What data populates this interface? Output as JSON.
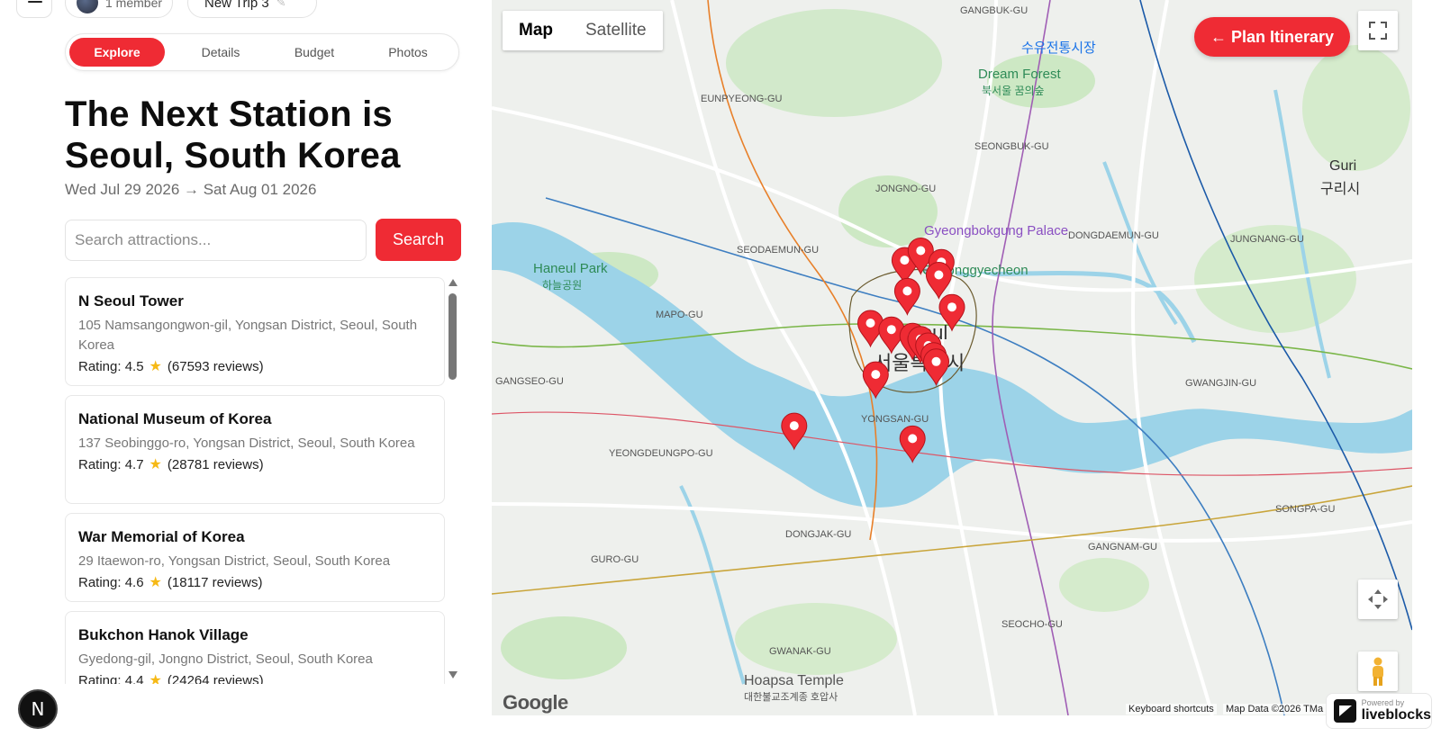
{
  "header": {
    "member_label": "1 member",
    "trip_name": "New Trip 3"
  },
  "tabs": [
    {
      "label": "Explore",
      "active": true
    },
    {
      "label": "Details",
      "active": false
    },
    {
      "label": "Budget",
      "active": false
    },
    {
      "label": "Photos",
      "active": false
    }
  ],
  "trip": {
    "title": "The Next Station is Seoul, South Korea",
    "dates": "Wed Jul 29 2026 → Sat Aug 01 2026"
  },
  "search": {
    "placeholder": "Search attractions...",
    "button_label": "Search"
  },
  "attractions": [
    {
      "name": "N Seoul Tower",
      "address": "105 Namsangongwon-gil, Yongsan District, Seoul, South Korea",
      "rating_text": "Rating: 4.5",
      "reviews_text": "(67593 reviews)"
    },
    {
      "name": "National Museum of Korea",
      "address": "137 Seobinggo-ro, Yongsan District, Seoul, South Korea",
      "rating_text": "Rating: 4.7",
      "reviews_text": "(28781 reviews)"
    },
    {
      "name": "War Memorial of Korea",
      "address": "29 Itaewon-ro, Yongsan District, Seoul, South Korea",
      "rating_text": "Rating: 4.6",
      "reviews_text": "(18117 reviews)"
    },
    {
      "name": "Bukchon Hanok Village",
      "address": "Gyedong-gil, Jongno District, Seoul, South Korea",
      "rating_text": "Rating: 4.4",
      "reviews_text": "(24264 reviews)"
    }
  ],
  "map": {
    "type_buttons": [
      "Map",
      "Satellite"
    ],
    "active_type": "Map",
    "plan_button": "← Plan Itinerary",
    "labels": {
      "seoul_en": "Seoul",
      "seoul_ko": "서울특별시",
      "guri_en": "Guri",
      "guri_ko": "구리시",
      "gyeongbokgung": "Gyeongbokgung Palace",
      "cheonggyecheon": "Cheonggyecheon",
      "dream_forest": "Dream Forest",
      "dream_forest_ko": "북서울 꿈의숲",
      "haneul_park": "Haneul Park",
      "haneul_park_ko": "하늘공원",
      "market": "수유전통시장",
      "hoapsa": "Hoapsa Temple",
      "hoapsa_ko": "대한불교조계종 호압사",
      "yongsan_gu": "YONGSAN-GU",
      "yeongdeungpo": "YEONGDEUNGPO-GU",
      "mapo": "MAPO-GU",
      "jongno": "JONGNO-GU",
      "seongbuk": "SEONGBUK-GU",
      "gangnam": "GANGNAM-GU",
      "seocho": "SEOCHO-GU",
      "gwanak": "GWANAK-GU",
      "dongjak": "DONGJAK-GU",
      "gangbuk": "GANGBUK-GU",
      "eunpyeong": "EUNPYEONG-GU",
      "seodaemun": "SEODAEMUN-GU",
      "dongdaemun": "DONGDAEMUN-GU",
      "jungnang": "JUNGNANG-GU",
      "gwangjin": "GWANGJIN-GU",
      "songpa": "SONGPA-GU",
      "guro": "GURO-GU",
      "gangseo": "GANGSEO-GU"
    },
    "footer": {
      "google": "Google",
      "keyboard": "Keyboard shortcuts",
      "map_data": "Map Data ©2026 TMa"
    }
  },
  "liveblocks": {
    "powered_by": "Powered by",
    "name": "liveblocks"
  },
  "next_logo": "N",
  "colors": {
    "accent": "#ef2b34",
    "star": "#f6b916",
    "river": "#9cd3e8",
    "park": "#c8e6c0"
  },
  "markers": [
    {
      "lat": 37.5796,
      "lng": 126.977
    },
    {
      "lat": 37.5826,
      "lng": 126.9831
    },
    {
      "lat": 37.579,
      "lng": 126.991
    },
    {
      "lat": 37.575,
      "lng": 126.99
    },
    {
      "lat": 37.57,
      "lng": 126.978
    },
    {
      "lat": 37.565,
      "lng": 126.995
    },
    {
      "lat": 37.56,
      "lng": 126.964
    },
    {
      "lat": 37.558,
      "lng": 126.972
    },
    {
      "lat": 37.556,
      "lng": 126.98
    },
    {
      "lat": 37.555,
      "lng": 126.983
    },
    {
      "lat": 37.553,
      "lng": 126.986
    },
    {
      "lat": 37.55,
      "lng": 126.988
    },
    {
      "lat": 37.548,
      "lng": 126.989
    },
    {
      "lat": 37.544,
      "lng": 126.966
    },
    {
      "lat": 37.528,
      "lng": 126.935
    },
    {
      "lat": 37.524,
      "lng": 126.98
    }
  ]
}
